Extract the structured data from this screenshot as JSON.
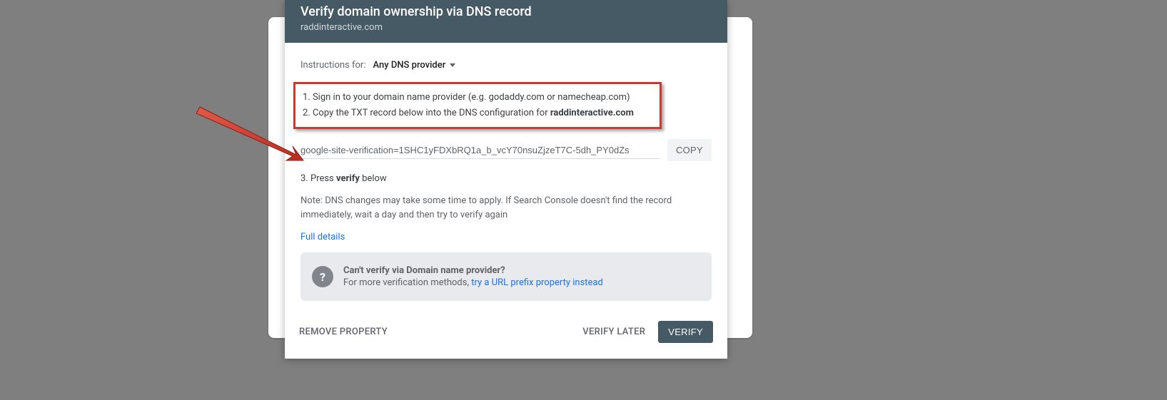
{
  "header": {
    "title": "Verify domain ownership via DNS record",
    "subtitle": "raddinteractive.com"
  },
  "instructions": {
    "label": "Instructions for:",
    "provider": "Any DNS provider"
  },
  "steps": {
    "one": "1. Sign in to your domain name provider (e.g. godaddy.com or namecheap.com)",
    "two_prefix": "2. Copy the TXT record below into the DNS configuration for ",
    "two_domain": "raddinteractive.com"
  },
  "txt": {
    "value": "google-site-verification=1SHC1yFDXbRQ1a_b_vcY70nsuZjzeT7C-5dh_PY0dZs",
    "copy": "COPY"
  },
  "step3": {
    "prefix": "3. Press ",
    "bold": "verify",
    "suffix": " below"
  },
  "note": "Note: DNS changes may take some time to apply. If Search Console doesn't find the record immediately, wait a day and then try to verify again",
  "details_link": "Full details",
  "hint": {
    "title": "Can't verify via Domain name provider?",
    "sub_prefix": "For more verification methods, ",
    "sub_link": "try a URL prefix property instead"
  },
  "footer": {
    "remove": "REMOVE PROPERTY",
    "later": "VERIFY LATER",
    "verify": "VERIFY"
  },
  "colors": {
    "accent": "#cc3a2d",
    "header": "#455a64",
    "link": "#1a73e8"
  }
}
